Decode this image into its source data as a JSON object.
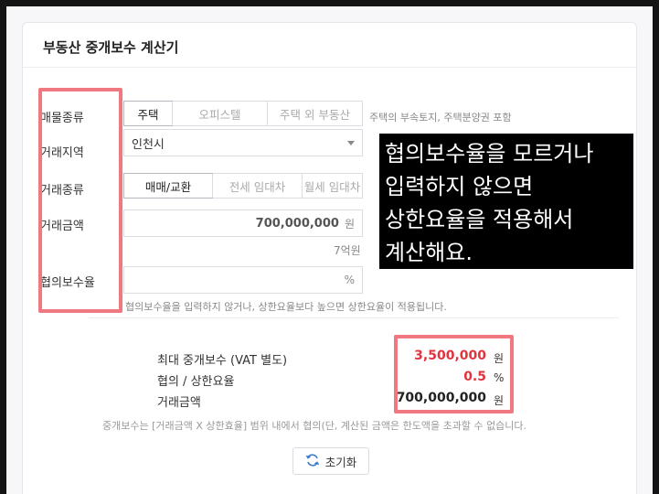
{
  "title": "부동산 중개보수 계산기",
  "labels": {
    "property_type": "매물종류",
    "region": "거래지역",
    "trade_type": "거래종류",
    "amount": "거래금액",
    "rate": "협의보수율"
  },
  "property_types": [
    "주택",
    "오피스텔",
    "주택 외 부동산"
  ],
  "property_hint": "주택의 부속토지, 주택분양권 포함",
  "region_value": "인천시",
  "trade_types": [
    "매매/교환",
    "전세 임대차",
    "월세 임대차"
  ],
  "amount_value": "700,000,000",
  "amount_unit": "원",
  "amount_korean": "7억원",
  "rate_unit": "%",
  "rate_hint": "협의보수율을 입력하지 않거나, 상한요율보다 높으면 상한요율이 적용됩니다.",
  "results": {
    "max_fee_label": "최대 중개보수 (VAT 별도)",
    "max_fee_value": "3,500,000",
    "max_fee_unit": "원",
    "rate_label": "협의 / 상한요율",
    "rate_value": "0.5",
    "rate_unit": "%",
    "amount_label": "거래금액",
    "amount_value": "700,000,000",
    "amount_unit": "원"
  },
  "note": "중개보수는 [거래금액 X 상한효율] 범위 내에서 협의(단, 계산된 금액은 한도액을 초과할 수 없습니다.",
  "reset_label": "초기화",
  "callout_lines": [
    "협의보수율을 모르거나",
    "입력하지 않으면",
    "상한요율을 적용해서",
    "계산해요."
  ],
  "colors": {
    "highlight": "#f07880",
    "result_red": "#e0343e"
  }
}
